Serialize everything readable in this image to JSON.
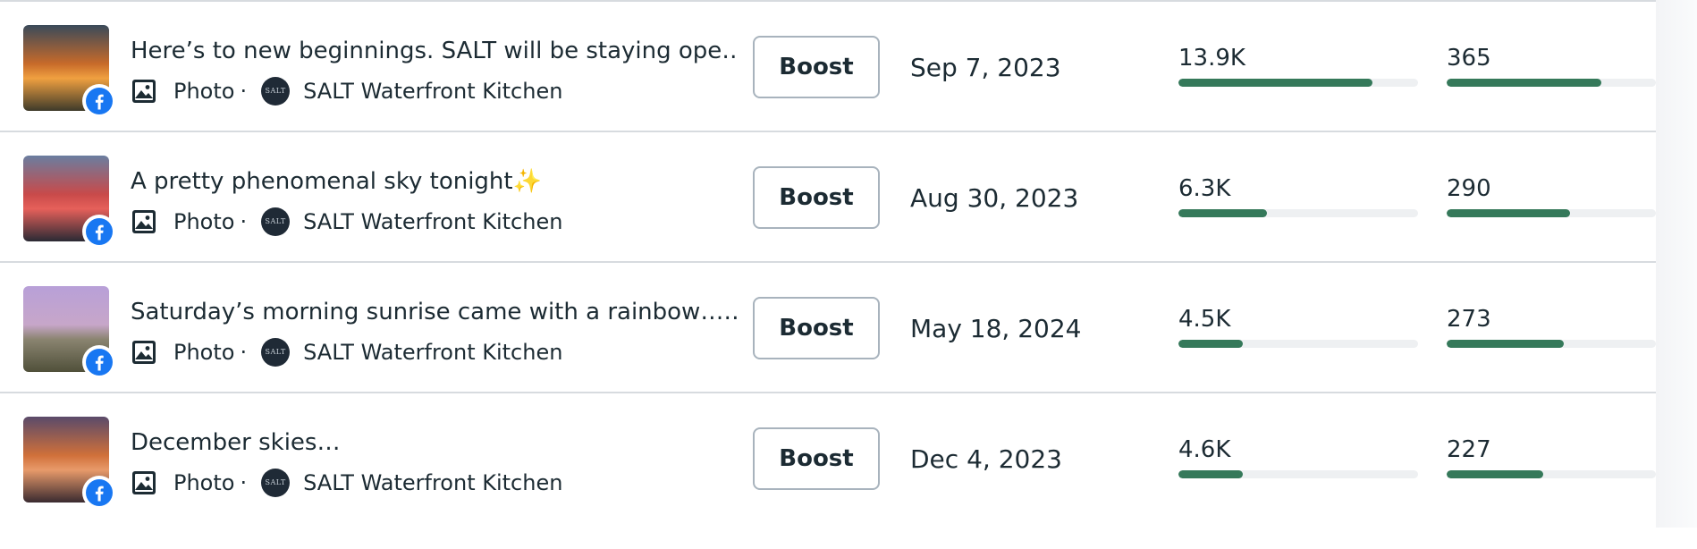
{
  "posts": [
    {
      "title": "Here’s to new beginnings. SALT will be staying ope…",
      "type": "Photo",
      "separator": "·",
      "page_name": "SALT Waterfront Kitchen",
      "page_avatar_text": "SALT",
      "boost_label": "Boost",
      "date": "Sep 7, 2023",
      "reach": "13.9K",
      "reach_fraction": 0.81,
      "engagement": "365",
      "engagement_fraction": 0.74,
      "thumb_colors": [
        "#3a4a5a",
        "#c76a2a",
        "#f0a040",
        "#3e3a2a"
      ],
      "platform_icon": "facebook-icon",
      "type_icon": "photo-icon"
    },
    {
      "title": "A pretty phenomenal sky tonight✨",
      "type": "Photo",
      "separator": "·",
      "page_name": "SALT Waterfront Kitchen",
      "page_avatar_text": "SALT",
      "boost_label": "Boost",
      "date": "Aug 30, 2023",
      "reach": "6.3K",
      "reach_fraction": 0.37,
      "engagement": "290",
      "engagement_fraction": 0.59,
      "thumb_colors": [
        "#6a7ea0",
        "#c84a4a",
        "#e6605a",
        "#2a2a34"
      ],
      "platform_icon": "facebook-icon",
      "type_icon": "photo-icon"
    },
    {
      "title": "Saturday’s morning sunrise came with a rainbow……",
      "type": "Photo",
      "separator": "·",
      "page_name": "SALT Waterfront Kitchen",
      "page_avatar_text": "SALT",
      "boost_label": "Boost",
      "date": "May 18, 2024",
      "reach": "4.5K",
      "reach_fraction": 0.27,
      "engagement": "273",
      "engagement_fraction": 0.56,
      "thumb_colors": [
        "#b8a0d8",
        "#c7a6c9",
        "#8a8470",
        "#50503a"
      ],
      "platform_icon": "facebook-icon",
      "type_icon": "photo-icon"
    },
    {
      "title": "December skies…",
      "type": "Photo",
      "separator": "·",
      "page_name": "SALT Waterfront Kitchen",
      "page_avatar_text": "SALT",
      "boost_label": "Boost",
      "date": "Dec 4, 2023",
      "reach": "4.6K",
      "reach_fraction": 0.27,
      "engagement": "227",
      "engagement_fraction": 0.46,
      "thumb_colors": [
        "#5a4a6a",
        "#d0703a",
        "#e89a6a",
        "#3a2a30"
      ],
      "platform_icon": "facebook-icon",
      "type_icon": "photo-icon"
    }
  ],
  "colors": {
    "bar_fill": "#35795a",
    "bar_track": "#eef0f2",
    "facebook_blue": "#1877f2",
    "divider": "#d7dbdf",
    "text": "#1c2b33"
  }
}
